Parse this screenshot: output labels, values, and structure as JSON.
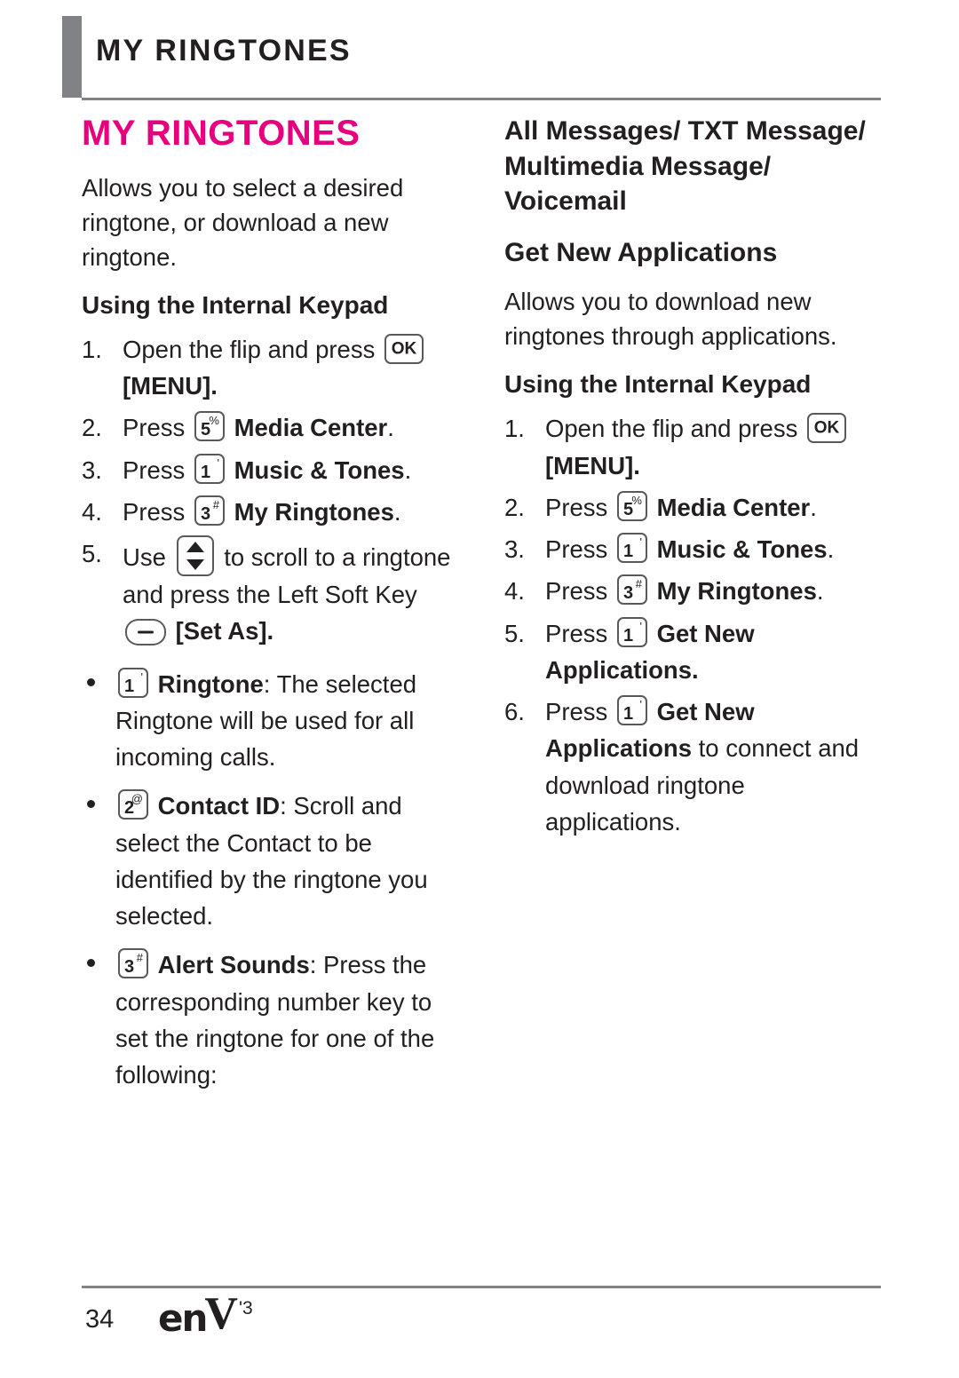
{
  "header": {
    "running_head": "MY RINGTONES"
  },
  "left_column": {
    "title": "MY RINGTONES",
    "intro": "Allows you to select a desired ringtone, or download a new ringtone.",
    "subhead": "Using the Internal Keypad",
    "steps": [
      {
        "num": "1.",
        "text_before": "Open the flip and press",
        "key": "OK",
        "text_after": "[MENU]."
      },
      {
        "num": "2.",
        "text_before": "Press",
        "key_digit": "5",
        "key_sup": "%",
        "bold_after": "Media Center",
        "tail": "."
      },
      {
        "num": "3.",
        "text_before": "Press",
        "key_digit": "1",
        "key_sup": "'",
        "bold_after": "Music & Tones",
        "tail": "."
      },
      {
        "num": "4.",
        "text_before": "Press",
        "key_digit": "3",
        "key_sup": "#",
        "bold_after": "My Ringtones",
        "tail": "."
      },
      {
        "num": "5.",
        "text_before": "Use",
        "key": "nav",
        "text_after": "to scroll to a ringtone and press the Left Soft Key",
        "softkey_label": "[Set As]."
      }
    ],
    "bullets": [
      {
        "key_digit": "1",
        "key_sup": "'",
        "bold": "Ringtone",
        "text": ": The selected Ringtone will be used for all incoming calls."
      },
      {
        "key_digit": "2",
        "key_sup": "@",
        "bold": "Contact ID",
        "text": ": Scroll and select the Contact to be identified by the ringtone you selected."
      },
      {
        "key_digit": "3",
        "key_sup": "#",
        "bold": "Alert Sounds",
        "text": ": Press the corresponding number key to set the ringtone for one of the following:"
      }
    ]
  },
  "right_column": {
    "heading_list": "All Messages/ TXT Message/ Multimedia Message/ Voicemail",
    "heading_section": "Get New Applications",
    "intro": "Allows you to download new ringtones through applications.",
    "subhead": "Using the Internal Keypad",
    "steps": [
      {
        "num": "1.",
        "text_before": "Open the flip and press",
        "key": "OK",
        "text_after": "[MENU]."
      },
      {
        "num": "2.",
        "text_before": "Press",
        "key_digit": "5",
        "key_sup": "%",
        "bold_after": "Media Center",
        "tail": "."
      },
      {
        "num": "3.",
        "text_before": "Press",
        "key_digit": "1",
        "key_sup": "'",
        "bold_after": "Music & Tones",
        "tail": "."
      },
      {
        "num": "4.",
        "text_before": "Press",
        "key_digit": "3",
        "key_sup": "#",
        "bold_after": "My Ringtones",
        "tail": "."
      },
      {
        "num": "5.",
        "text_before": "Press",
        "key_digit": "1",
        "key_sup": "'",
        "bold_after": "Get New Applications",
        "tail": "."
      },
      {
        "num": "6.",
        "text_before": "Press",
        "key_digit": "1",
        "key_sup": "'",
        "bold_after": "Get New Applications",
        "tail": " to connect and download ringtone applications."
      }
    ]
  },
  "footer": {
    "page_number": "34",
    "logo_en": "en",
    "logo_v": "V",
    "logo_three": "'3"
  },
  "colors": {
    "accent": "#e6007e",
    "rule": "#808285",
    "text": "#231f20"
  }
}
